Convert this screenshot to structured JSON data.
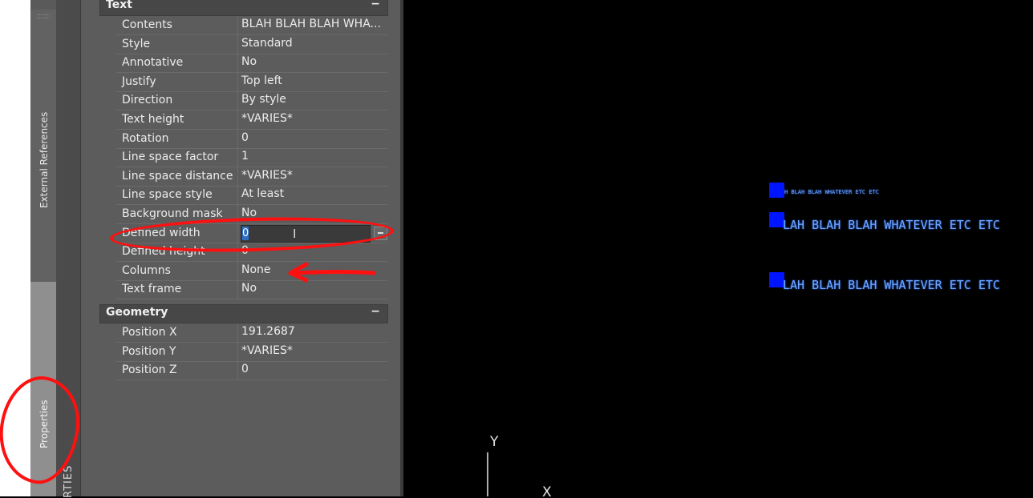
{
  "tabs": {
    "external_references": "External References",
    "properties": "Properties",
    "palette_title": "RTIES"
  },
  "sections": {
    "text": {
      "title": "Text",
      "toggle": "−"
    },
    "geometry": {
      "title": "Geometry",
      "toggle": "−"
    }
  },
  "text_props": [
    {
      "name": "Contents",
      "value": "BLAH BLAH BLAH WHA..."
    },
    {
      "name": "Style",
      "value": "Standard"
    },
    {
      "name": "Annotative",
      "value": "No"
    },
    {
      "name": "Justify",
      "value": "Top left"
    },
    {
      "name": "Direction",
      "value": "By style"
    },
    {
      "name": "Text height",
      "value": "*VARIES*"
    },
    {
      "name": "Rotation",
      "value": "0"
    },
    {
      "name": "Line space factor",
      "value": "1"
    },
    {
      "name": "Line space distance",
      "value": "*VARIES*"
    },
    {
      "name": "Line space style",
      "value": "At least"
    },
    {
      "name": "Background mask",
      "value": "No"
    },
    {
      "name": "Defined width",
      "value": "0"
    },
    {
      "name": "Defined height",
      "value": "0"
    },
    {
      "name": "Columns",
      "value": "None"
    },
    {
      "name": "Text frame",
      "value": "No"
    }
  ],
  "geometry_props": [
    {
      "name": "Position X",
      "value": "191.2687"
    },
    {
      "name": "Position Y",
      "value": "*VARIES*"
    },
    {
      "name": "Position Z",
      "value": "0"
    }
  ],
  "canvas": {
    "text_small": "H BLAH BLAH WHATEVER ETC ETC",
    "text_large_1": "LAH BLAH BLAH WHATEVER ETC ETC",
    "text_large_2": "LAH BLAH BLAH WHATEVER ETC ETC",
    "ucs_y": "Y",
    "ucs_x": "X"
  },
  "colors": {
    "annotation_red": "#ff1010",
    "grip_blue": "#0015ff",
    "text_blue": "#6ea7ff"
  }
}
